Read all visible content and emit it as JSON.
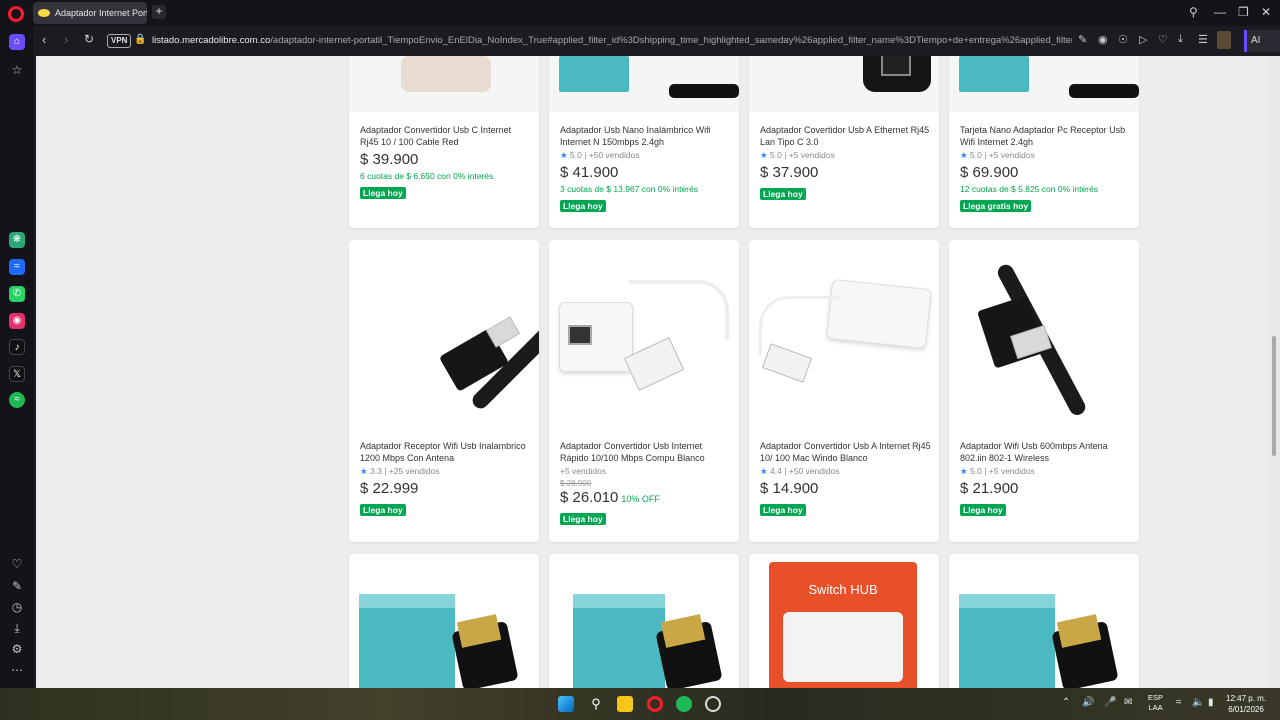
{
  "browser": {
    "tab_title": "Adaptador Internet Portal",
    "url_host": "listado.mercadolibre.com.co",
    "url_rest": "/adaptador-internet-portatil_TiempoEnvio_EnElDia_NoIndex_True#applied_filter_id%3Dshipping_time_highlighted_sameday%26applied_filter_name%3DTiempo+de+entrega%26applied_filter_order%3D1%26appli",
    "vpn_label": "VPN",
    "aria_label": "AI"
  },
  "products": [
    {
      "title": "Adaptador Convertidor Usb C Internet Rj45 10 / 100 Cable Red",
      "rating": "",
      "sold": "",
      "old_price": "",
      "price": "$ 39.900",
      "off": "",
      "cuotas": "6 cuotas de $ 6.650 con 0% interés",
      "badge": "Llega hoy"
    },
    {
      "title": "Adaptador Usb Nano Inalámbrico Wifi Internet N 150mbps 2.4gh",
      "rating": "5.0",
      "sold": "| +50 vendidos",
      "old_price": "",
      "price": "$ 41.900",
      "off": "",
      "cuotas": "3 cuotas de $ 13.967 con 0% interés",
      "badge": "Llega hoy"
    },
    {
      "title": "Adaptador Covertidor Usb A Ethernet Rj45 Lan Tipo C 3.0",
      "rating": "5.0",
      "sold": "| +5 vendidos",
      "old_price": "",
      "price": "$ 37.900",
      "off": "",
      "cuotas": "",
      "badge": "Llega hoy"
    },
    {
      "title": "Tarjeta Nano Adaptador Pc Receptor Usb Wifi Internet 2.4gh",
      "rating": "5.0",
      "sold": "| +5 vendidos",
      "old_price": "",
      "price": "$ 69.900",
      "off": "",
      "cuotas": "12 cuotas de $ 5.825 con 0% interés",
      "badge": "Llega gratis hoy"
    },
    {
      "title": "Adaptador Receptor Wifi Usb Inalambrico 1200 Mbps Con Antena",
      "rating": "3.3",
      "sold": "| +25 vendidos",
      "old_price": "",
      "price": "$ 22.999",
      "off": "",
      "cuotas": "",
      "badge": "Llega hoy"
    },
    {
      "title": "Adaptador Convertidor Usb Internet Rápido 10/100 Mbps Compu Blanco",
      "rating": "",
      "sold": "+5 vendidos",
      "old_price": "$ 28.900",
      "price": "$ 26.010",
      "off": "10% OFF",
      "cuotas": "",
      "badge": "Llega hoy"
    },
    {
      "title": "Adaptador Convertidor Usb A Internet Rj45 10/ 100 Mac Windo Blanco",
      "rating": "4.4",
      "sold": "| +50 vendidos",
      "old_price": "",
      "price": "$ 14.900",
      "off": "",
      "cuotas": "",
      "badge": "Llega hoy"
    },
    {
      "title": "Adaptador Wifi Usb 600mbps Antena 802.iin 802-1 Wireless",
      "rating": "5.0",
      "sold": "| +5 vendidos",
      "old_price": "",
      "price": "$ 21.900",
      "off": "",
      "cuotas": "",
      "badge": "Llega hoy"
    }
  ],
  "switch_hub_label": "Switch HUB",
  "taskbar": {
    "lang_top": "ESP",
    "lang_bottom": "LAA",
    "time": "12:47 p. m.",
    "date": "6/01/2026"
  }
}
